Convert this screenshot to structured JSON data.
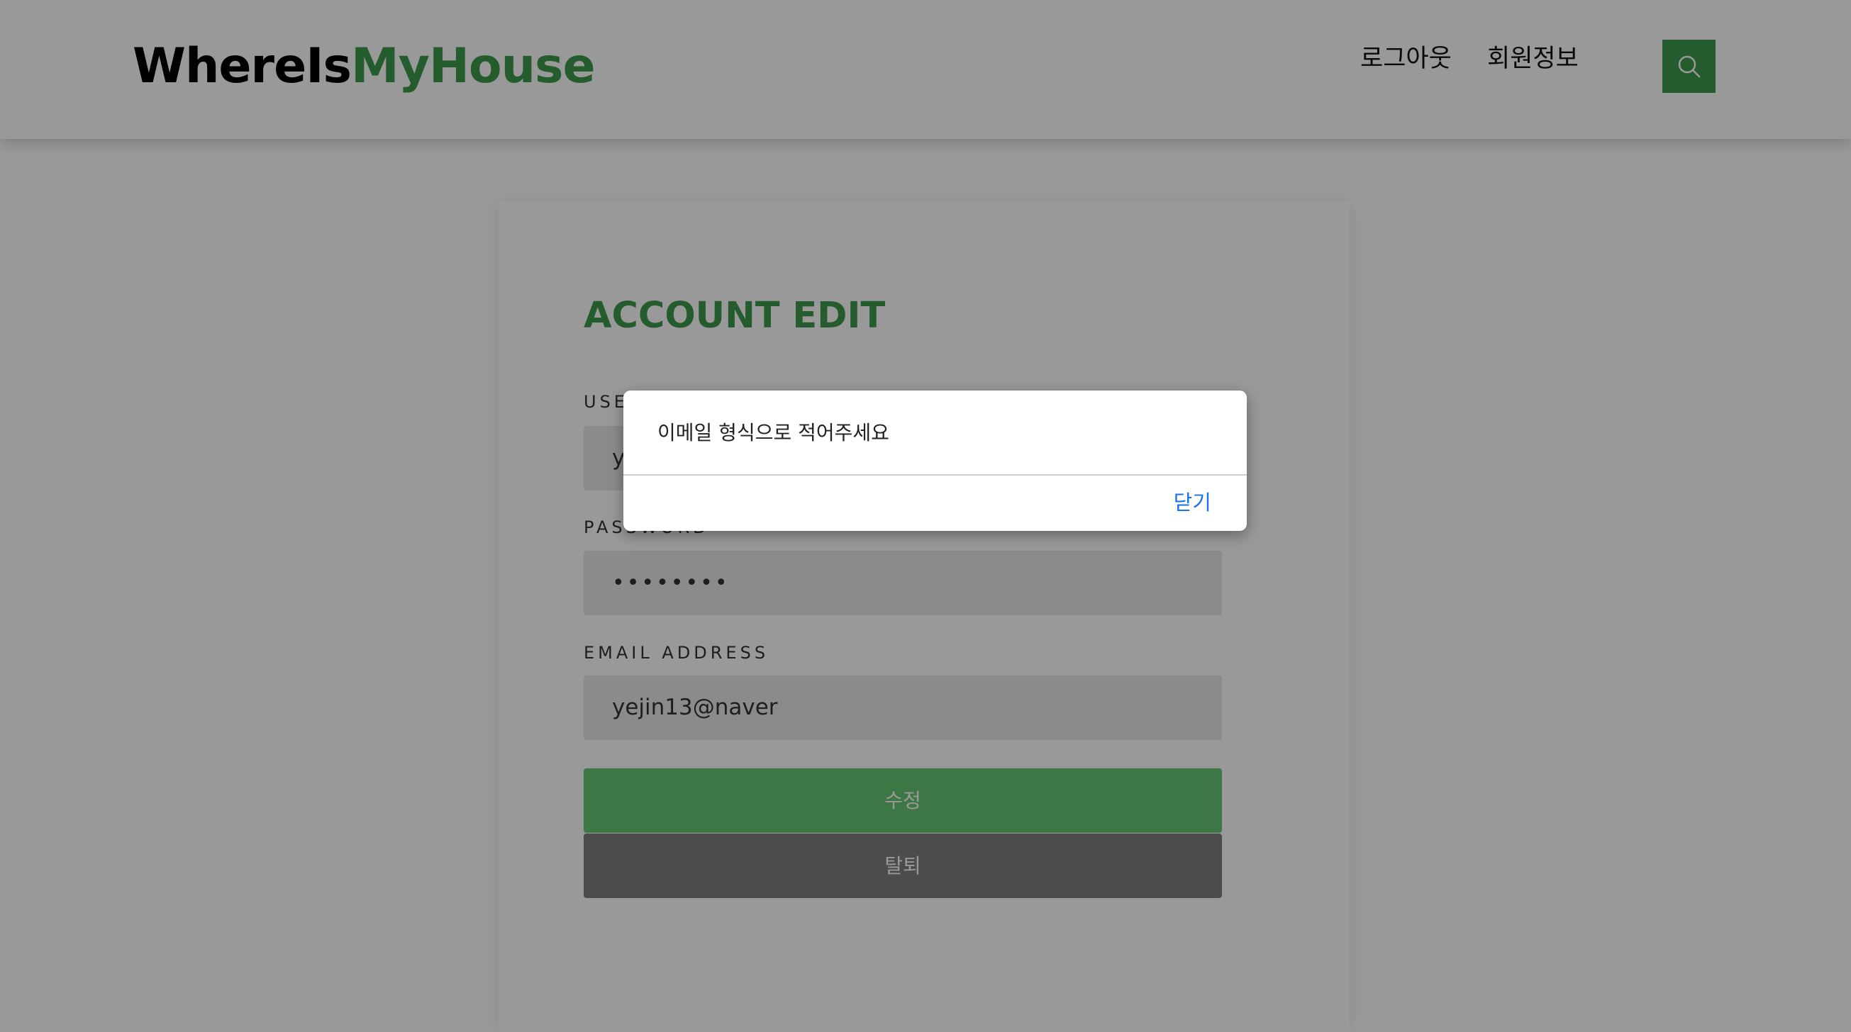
{
  "header": {
    "logo_part1": "WhereIs",
    "logo_part2": "MyHouse",
    "nav": {
      "logout": "로그아웃",
      "member_info": "회원정보"
    },
    "search_icon": "search-icon"
  },
  "form": {
    "title": "ACCOUNT EDIT",
    "username": {
      "label": "USERNAME",
      "value": "yejin13"
    },
    "password": {
      "label": "PASSWORD",
      "value": "••••••••"
    },
    "email": {
      "label": "EMAIL ADDRESS",
      "value": "yejin13@naver"
    },
    "edit_button": "수정",
    "delete_button": "탈퇴"
  },
  "dialog": {
    "message": "이메일 형식으로 적어주세요",
    "close_label": "닫기"
  },
  "colors": {
    "brand_green": "#3f9a4c",
    "link_blue": "#1a73e8",
    "delete_gray": "#7f7f7f"
  }
}
